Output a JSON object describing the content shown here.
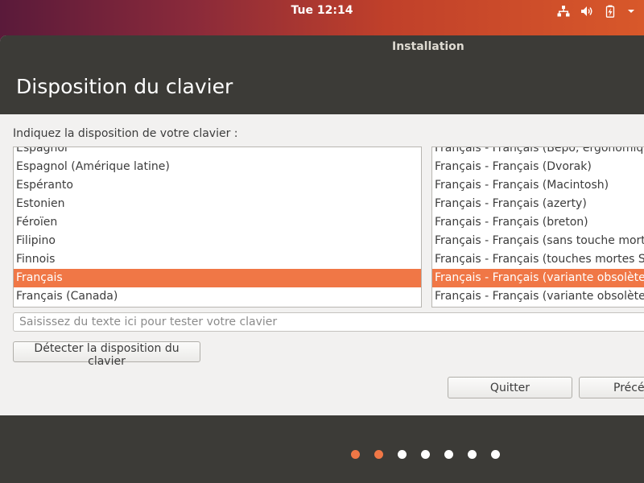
{
  "topbar": {
    "clock": "Tue 12:14",
    "icons": [
      "network-icon",
      "volume-icon",
      "battery-icon",
      "system-menu-icon"
    ]
  },
  "window": {
    "title": "Installation",
    "page_title": "Disposition du clavier",
    "prompt": "Indiquez la disposition de votre clavier :"
  },
  "layouts": {
    "items": [
      "Espagnol",
      "Espagnol (Amérique latine)",
      "Espéranto",
      "Estonien",
      "Féroïen",
      "Filipino",
      "Finnois",
      "Français",
      "Français (Canada)"
    ],
    "selected": "Français"
  },
  "variants": {
    "items": [
      "Français - Français (Bépo, ergonomique",
      "Français - Français (Dvorak)",
      "Français - Français (Macintosh)",
      "Français - Français (azerty)",
      "Français - Français (breton)",
      "Français - Français (sans touche morte S",
      "Français - Français (touches mortes Sun",
      "Français - Français (variante obsolète)",
      "Français - Français (variante obsolète, s"
    ],
    "selected": "Français - Français (variante obsolète)"
  },
  "test_field": {
    "value": "",
    "placeholder": "Saisissez du texte ici pour tester votre clavier"
  },
  "buttons": {
    "detect": "Détecter la disposition du clavier",
    "quit": "Quitter",
    "back": "Précé"
  },
  "progress": {
    "total_steps": 7,
    "completed_steps": 2
  },
  "colors": {
    "accent": "#f07746",
    "header": "#3c3b37"
  }
}
